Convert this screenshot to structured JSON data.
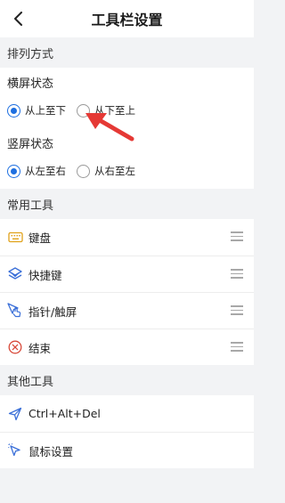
{
  "header": {
    "title": "工具栏设置"
  },
  "arrangement": {
    "section_label": "排列方式",
    "landscape": {
      "title": "横屏状态",
      "options": [
        {
          "label": "从上至下",
          "checked": true
        },
        {
          "label": "从下至上",
          "checked": false
        }
      ]
    },
    "portrait": {
      "title": "竖屏状态",
      "options": [
        {
          "label": "从左至右",
          "checked": true
        },
        {
          "label": "从右至左",
          "checked": false
        }
      ]
    }
  },
  "common_tools": {
    "section_label": "常用工具",
    "items": [
      {
        "label": "键盘",
        "icon": "keyboard-icon"
      },
      {
        "label": "快捷键",
        "icon": "shortcut-icon"
      },
      {
        "label": "指针/触屏",
        "icon": "pointer-touch-icon"
      },
      {
        "label": "结束",
        "icon": "close-circle-icon"
      }
    ]
  },
  "other_tools": {
    "section_label": "其他工具",
    "items": [
      {
        "label": "Ctrl+Alt+Del",
        "icon": "send-icon"
      },
      {
        "label": "鼠标设置",
        "icon": "mouse-cursor-icon"
      }
    ]
  },
  "colors": {
    "accent": "#1e6fe0",
    "arrow_red": "#e53935",
    "background": "#f2f3f5"
  }
}
